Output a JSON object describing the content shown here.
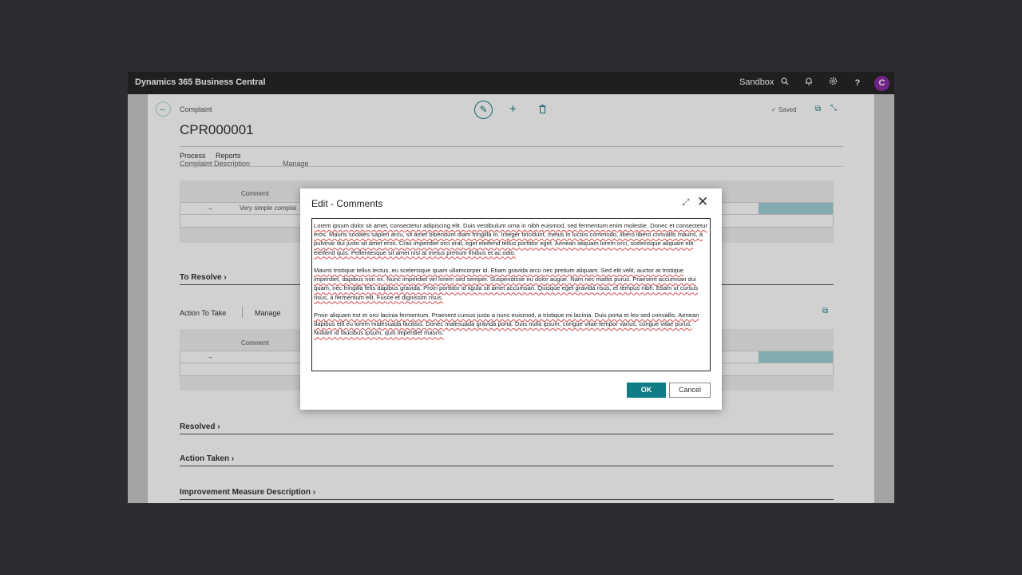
{
  "topbar": {
    "brand": "Dynamics 365 Business Central",
    "environment": "Sandbox",
    "avatar_initial": "C",
    "help": "?"
  },
  "page": {
    "breadcrumb": "Complaint",
    "title": "CPR000001",
    "saved": "✓ Saved",
    "menu": {
      "process": "Process",
      "reports": "Reports"
    },
    "cut_section": "Complaint Description",
    "cut_manage": "Manage",
    "grid1": {
      "header": "Comment",
      "cell": "Very simple complai"
    },
    "to_resolve": "To Resolve",
    "action_to_take": "Action To Take",
    "action_manage": "Manage",
    "grid2": {
      "header": "Comment"
    },
    "resolved": "Resolved",
    "action_taken": "Action Taken",
    "improvement": "Improvement Measure Description"
  },
  "dialog": {
    "title": "Edit - Comments",
    "paragraphs": [
      "Lorem ipsum dolor sit amet, consectetur adipiscing elit. Duis vestibulum urna in nibh euismod, sed fermentum enim molestie. Donec et consectetur eros. Mauris sodales sapien arcu, sit amet bibendum diam fringilla in. Integer tincidunt, metus in luctus commodo, libero libero convallis mauris, a pulvinar dui justo sit amet eros. Cras imperdiet orci erat, eget eleifend tellus porttitor eget. Aenean aliquam lorem orci, scelerisque aliquam elit eleifend quis. Pellentesque sit amet nisl at metus pretium finibus et ac odio.",
      "Mauris tristique tellus lectus, eu scelerisque quam ullamcorper id. Etiam gravida arcu nec pretium aliquam. Sed elit velit, auctor at tristique imperdiet, dapibus non ex. Nunc imperdiet vel lorem sed semper. Suspendisse eu dolor augue. Nam nec mattis purus. Praesent accumsan dui quam, nec fringilla felis dapibus gravida. Proin porttitor id ligula sit amet accumsan. Quisque eget gravida risus, et tempus nibh. Etiam ut cursus risus, a fermentum elit. Fusce et dignissim risus.",
      "Proin aliquam est et orci lacinia fermentum. Praesent cursus justo a nunc euismod, a tristique mi lacinia. Duis porta et leo sed convallis. Aenean dapibus elit eu lorem malesuada facilisis. Donec malesuada gravida porta. Duis nulla ipsum, congue vitae tempor varius, congue vitae purus. Nullam id faucibus ipsum, quis imperdiet mauris."
    ],
    "ok_label": "OK",
    "cancel_label": "Cancel"
  },
  "colors": {
    "accent": "#107c85",
    "avatar": "#8a2ea6",
    "topbar": "#262626"
  },
  "icons": [
    "search-icon",
    "bell-icon",
    "gear-icon",
    "help-icon",
    "back-arrow-icon",
    "edit-icon",
    "add-icon",
    "delete-icon",
    "open-new-window-icon",
    "collapse-icon",
    "expand-icon",
    "close-icon"
  ]
}
